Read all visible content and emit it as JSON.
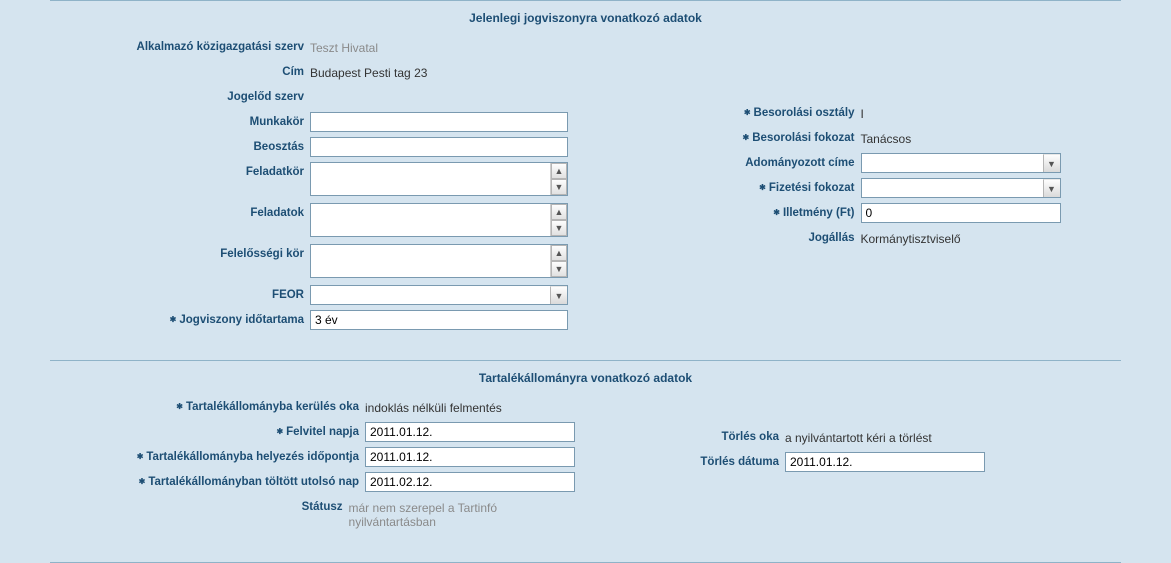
{
  "section1": {
    "title": "Jelenlegi jogviszonyra vonatkozó adatok",
    "left": {
      "alkalmazo_label": "Alkalmazó közigazgatási szerv",
      "alkalmazo_value": "Teszt Hivatal",
      "cim_label": "Cím",
      "cim_value": "Budapest Pesti tag 23",
      "jogelod_label": "Jogelőd szerv",
      "jogelod_value": "",
      "munkakor_label": "Munkakör",
      "munkakor_value": "",
      "beosztas_label": "Beosztás",
      "beosztas_value": "",
      "feladatkor_label": "Feladatkör",
      "feladatkor_value": "",
      "feladatok_label": "Feladatok",
      "feladatok_value": "",
      "felelossegi_label": "Felelősségi kör",
      "felelossegi_value": "",
      "feor_label": "FEOR",
      "feor_value": "",
      "jogviszony_idotartam_label": "Jogviszony időtartama",
      "jogviszony_idotartam_value": "3 év"
    },
    "right": {
      "besorolasi_osztaly_label": "Besorolási osztály",
      "besorolasi_osztaly_value": "I",
      "besorolasi_fokozat_label": "Besorolási fokozat",
      "besorolasi_fokozat_value": "Tanácsos",
      "adomanyozott_cime_label": "Adományozott címe",
      "adomanyozott_cime_value": "",
      "fizetesi_fokozat_label": "Fizetési fokozat",
      "fizetesi_fokozat_value": "",
      "illetmeny_label": "Illetmény (Ft)",
      "illetmeny_value": "0",
      "jogallas_label": "Jogállás",
      "jogallas_value": "Kormánytisztviselő"
    }
  },
  "section2": {
    "title": "Tartalékállományra vonatkozó adatok",
    "left": {
      "kerules_oka_label": "Tartalékállományba kerülés oka",
      "kerules_oka_value": "indoklás nélküli felmentés",
      "felvitel_napja_label": "Felvitel napja",
      "felvitel_napja_value": "2011.01.12.",
      "helyezes_idopont_label": "Tartalékállományba helyezés időpontja",
      "helyezes_idopont_value": "2011.01.12.",
      "utolso_nap_label": "Tartalékállományban töltött utolsó nap",
      "utolso_nap_value": "2011.02.12.",
      "statusz_label": "Státusz",
      "statusz_value": "már nem szerepel a Tartinfó nyilvántartásban"
    },
    "right": {
      "torles_oka_label": "Törlés oka",
      "torles_oka_value": "a nyilvántartott kéri a törlést",
      "torles_datuma_label": "Törlés dátuma",
      "torles_datuma_value": "2011.01.12."
    }
  }
}
